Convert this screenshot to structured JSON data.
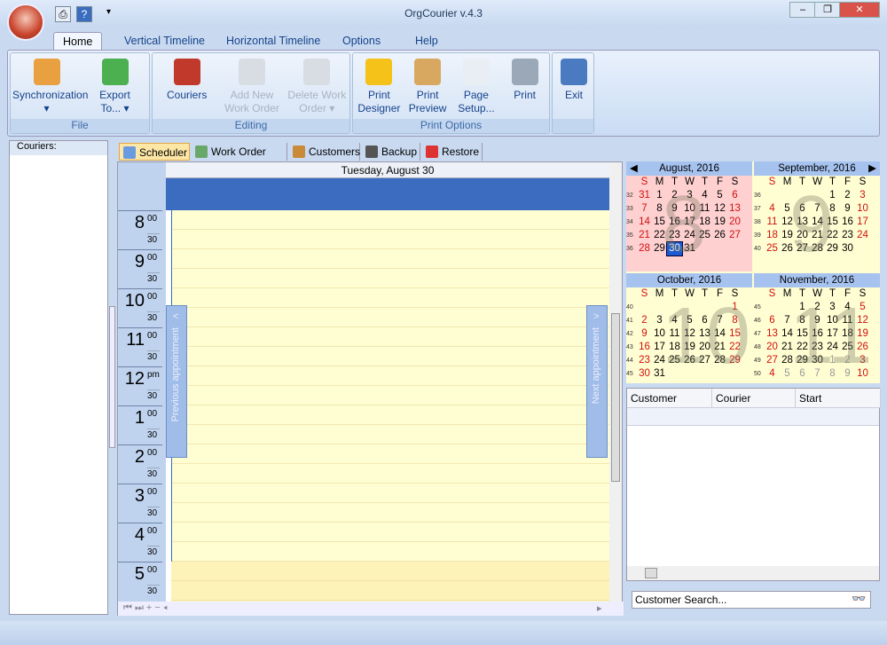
{
  "window": {
    "title": "OrgCourier v.4.3",
    "controls": [
      "minimize",
      "restore",
      "close"
    ]
  },
  "quick_access": [
    {
      "icon": "print-icon"
    },
    {
      "icon": "help-icon"
    }
  ],
  "ribbon_tabs": [
    "Home",
    "Vertical Timeline",
    "Horizontal Timeline",
    "Options",
    "Help"
  ],
  "groups": [
    {
      "label": "File",
      "buttons": [
        {
          "label": "Synchronization",
          "sub": "▾",
          "icon": "sync-icon"
        },
        {
          "label": "Export",
          "sub": "To... ▾",
          "icon": "export-icon"
        }
      ]
    },
    {
      "label": "Editing",
      "buttons": [
        {
          "label": "Couriers",
          "sub": "",
          "icon": "couriers-icon"
        },
        {
          "label": "Add New",
          "sub": "Work Order",
          "icon": "add-icon",
          "disabled": true
        },
        {
          "label": "Delete Work",
          "sub": "Order ▾",
          "icon": "delete-icon",
          "disabled": true
        }
      ]
    },
    {
      "label": "Print Options",
      "buttons": [
        {
          "label": "Print",
          "sub": "Designer",
          "icon": "gear-icon"
        },
        {
          "label": "Print",
          "sub": "Preview",
          "icon": "magnifier-icon"
        },
        {
          "label": "Page",
          "sub": "Setup...",
          "icon": "pages-icon"
        },
        {
          "label": "Print",
          "sub": "",
          "icon": "printer-icon"
        }
      ]
    },
    {
      "label": "",
      "buttons": [
        {
          "label": "Exit",
          "sub": "",
          "icon": "exit-door-icon"
        }
      ]
    }
  ],
  "left_panel": {
    "title": "Couriers:"
  },
  "doc_tabs": [
    {
      "label": "Scheduler",
      "active": true
    },
    {
      "label": "Work Order List"
    },
    {
      "label": "Customers"
    },
    {
      "label": "Backup"
    },
    {
      "label": "Restore"
    }
  ],
  "scheduler": {
    "date": "Tuesday, August 30",
    "hours": [
      {
        "h": "8",
        "m": "00"
      },
      {
        "h": "9",
        "m": "00"
      },
      {
        "h": "10",
        "m": "00"
      },
      {
        "h": "11",
        "m": "00"
      },
      {
        "h": "12",
        "m": "pm"
      },
      {
        "h": "1",
        "m": "00"
      },
      {
        "h": "2",
        "m": "00"
      },
      {
        "h": "3",
        "m": "00"
      },
      {
        "h": "4",
        "m": "00"
      },
      {
        "h": "5",
        "m": "00"
      }
    ],
    "half": "30",
    "prev": "Previous appointment",
    "next": "Next appointment"
  },
  "calendar": {
    "dow": [
      "S",
      "M",
      "T",
      "W",
      "T",
      "F",
      "S"
    ],
    "months": [
      {
        "title": "August, 2016",
        "big": "8",
        "weeks": [
          [
            "32",
            31,
            1,
            2,
            3,
            4,
            5,
            6
          ],
          [
            "33",
            7,
            8,
            9,
            10,
            11,
            12,
            13
          ],
          [
            "34",
            14,
            15,
            16,
            17,
            18,
            19,
            20
          ],
          [
            "35",
            21,
            22,
            23,
            24,
            25,
            26,
            27
          ],
          [
            "36",
            28,
            29,
            30,
            31,
            "",
            "",
            ""
          ]
        ],
        "selected": 30
      },
      {
        "title": "September, 2016",
        "big": "9",
        "weeks": [
          [
            "36",
            "",
            "",
            "",
            "",
            1,
            2,
            3
          ],
          [
            "37",
            4,
            5,
            6,
            7,
            8,
            9,
            10
          ],
          [
            "38",
            11,
            12,
            13,
            14,
            15,
            16,
            17
          ],
          [
            "39",
            18,
            19,
            20,
            21,
            22,
            23,
            24
          ],
          [
            "40",
            25,
            26,
            27,
            28,
            29,
            30,
            ""
          ]
        ]
      },
      {
        "title": "October, 2016",
        "big": "10",
        "weeks": [
          [
            "40",
            "",
            "",
            "",
            "",
            "",
            "",
            1
          ],
          [
            "41",
            2,
            3,
            4,
            5,
            6,
            7,
            8
          ],
          [
            "42",
            9,
            10,
            11,
            12,
            13,
            14,
            15
          ],
          [
            "43",
            16,
            17,
            18,
            19,
            20,
            21,
            22
          ],
          [
            "44",
            23,
            24,
            25,
            26,
            27,
            28,
            29
          ],
          [
            "45",
            30,
            31,
            "",
            "",
            "",
            "",
            ""
          ]
        ]
      },
      {
        "title": "November, 2016",
        "big": "11",
        "weeks": [
          [
            "45",
            "",
            "",
            1,
            2,
            3,
            4,
            5
          ],
          [
            "46",
            6,
            7,
            8,
            9,
            10,
            11,
            12
          ],
          [
            "47",
            13,
            14,
            15,
            16,
            17,
            18,
            19
          ],
          [
            "48",
            20,
            21,
            22,
            23,
            24,
            25,
            26
          ],
          [
            "49",
            27,
            28,
            29,
            30,
            "1*",
            "2*",
            3
          ],
          [
            "50",
            4,
            "5*",
            "6*",
            "7*",
            "8*",
            "9*",
            10
          ]
        ]
      }
    ]
  },
  "grid": {
    "columns": [
      "Customer",
      "Courier",
      "Start"
    ]
  },
  "search": {
    "placeholder": "Customer Search..."
  }
}
